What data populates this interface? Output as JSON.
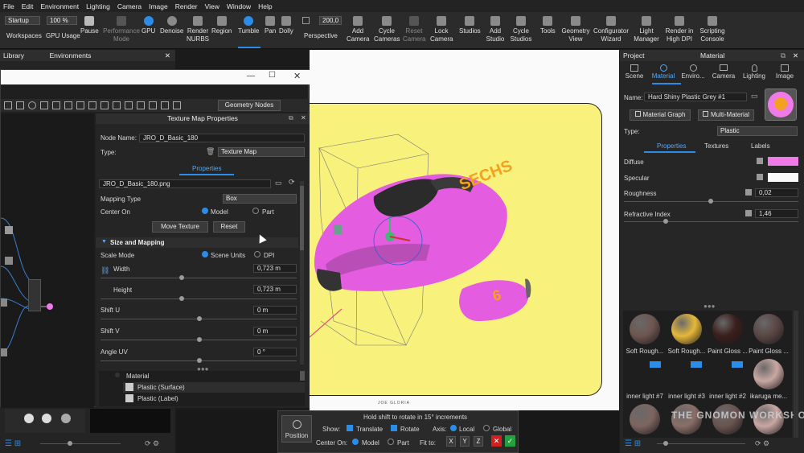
{
  "menu": [
    "File",
    "Edit",
    "Environment",
    "Lighting",
    "Camera",
    "Image",
    "Render",
    "View",
    "Window",
    "Help"
  ],
  "toolbar": {
    "mode": "Startup",
    "gpu_percent": "100 %",
    "workspaces": "Workspaces",
    "gpu_usage": "GPU Usage",
    "pause": "Pause",
    "performance_mode": "Performance Mode",
    "gpu": "GPU",
    "denoise": "Denoise",
    "render_nurbs": "Render NURBS",
    "region": "Region",
    "tumble": "Tumble",
    "pan": "Pan",
    "dolly": "Dolly",
    "perspective_value": "200,0",
    "perspective": "Perspective",
    "add_camera": "Add Camera",
    "cycle_cameras": "Cycle Cameras",
    "reset_camera": "Reset Camera",
    "lock_camera": "Lock Camera",
    "studios": "Studios",
    "add_studio": "Add Studio",
    "cycle_studios": "Cycle Studios",
    "tools": "Tools",
    "geometry_view": "Geometry View",
    "configurator_wizard": "Configurator Wizard",
    "light_manager": "Light Manager",
    "render_high_dpi": "Render in High DPI",
    "scripting_console": "Scripting Console"
  },
  "left": {
    "library": "Library",
    "environments": "Environments"
  },
  "graph": {
    "geometry_nodes": "Geometry Nodes"
  },
  "texture": {
    "title": "Texture Map Properties",
    "node_name_label": "Node Name:",
    "node_name": "JRO_D_Basic_180",
    "type_label": "Type:",
    "type_value": "Texture Map",
    "properties_tab": "Properties",
    "file": "JRO_D_Basic_180.png",
    "mapping_type_label": "Mapping Type",
    "mapping_type": "Box",
    "center_on_label": "Center On",
    "model": "Model",
    "part": "Part",
    "move_texture": "Move Texture",
    "reset": "Reset",
    "size_mapping": "Size and Mapping",
    "scale_mode_label": "Scale Mode",
    "scene_units": "Scene Units",
    "dpi": "DPI",
    "width_label": "Width",
    "width": "0,723 m",
    "height_label": "Height",
    "height": "0,723 m",
    "shift_u_label": "Shift U",
    "shift_u": "0 m",
    "shift_v_label": "Shift V",
    "shift_v": "0 m",
    "angle_uv_label": "Angle UV",
    "angle_uv": "0 °",
    "tree": [
      "Material",
      "Plastic (Surface)",
      "Plastic (Label)"
    ]
  },
  "viewport": {
    "decal_text": "SECHS",
    "fin_text": "6",
    "credit": "JOE GLORIA"
  },
  "hud": {
    "hint": "Hold shift to rotate in 15° increments",
    "position": "Position",
    "show": "Show:",
    "translate": "Translate",
    "rotate": "Rotate",
    "axis": "Axis:",
    "local": "Local",
    "global": "Global",
    "center_on": "Center On:",
    "model": "Model",
    "part": "Part",
    "fit_to": "Fit to:",
    "x": "X",
    "y": "Y",
    "z": "Z"
  },
  "project": {
    "title": "Project",
    "material_title": "Material",
    "tabs": [
      "Scene",
      "Material",
      "Enviro...",
      "Camera",
      "Lighting",
      "Image"
    ],
    "name_label": "Name:",
    "name": "Hard Shiny Plastic Grey #1",
    "material_graph": "Material Graph",
    "multi_material": "Multi-Material",
    "type_label": "Type:",
    "type": "Plastic",
    "sub_tabs": [
      "Properties",
      "Textures",
      "Labels"
    ],
    "diffuse": "Diffuse",
    "specular": "Specular",
    "roughness": "Roughness",
    "roughness_value": "0,02",
    "refractive_index": "Refractive Index",
    "refractive_value": "1,46"
  },
  "swatches": [
    {
      "name": "Soft Rough...",
      "color": "#6e5650"
    },
    {
      "name": "Soft Rough...",
      "color": "#e6b73a"
    },
    {
      "name": "Paint Gloss ...",
      "color": "#3a1e1c"
    },
    {
      "name": "Paint Gloss ...",
      "color": "#5a4644"
    },
    {
      "name": "inner light #7",
      "color": "#7d6560"
    },
    {
      "name": "inner light #3",
      "color": "#8a6e68"
    },
    {
      "name": "inner light #2",
      "color": "#6a5450"
    },
    {
      "name": "ikaruga me...",
      "color": "#c9a7a2"
    }
  ],
  "watermark": "THE GNOMON WORKSHOP",
  "colors": {
    "accent": "#2b8de8",
    "viewport_bg": "#f8f27c",
    "car_pink": "#e45ce0",
    "diffuse": "#f07ae8"
  }
}
